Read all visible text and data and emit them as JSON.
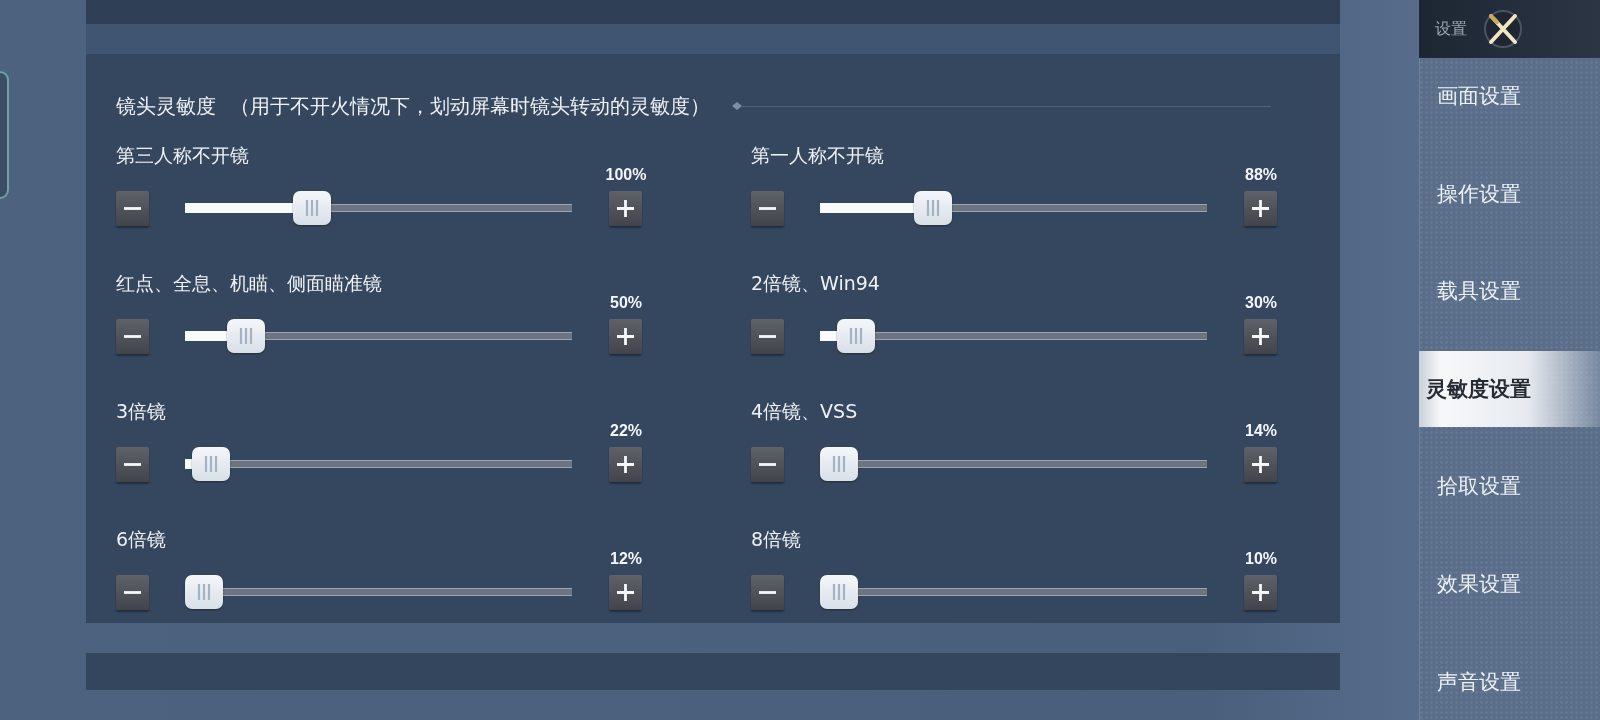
{
  "panel": {
    "title": "镜头灵敏度",
    "note": "（用于不开火情况下，划动屏幕时镜头转动的灵敏度）",
    "sliders": [
      {
        "label": "第三人称不开镜",
        "reading": "100%",
        "level": 0.31
      },
      {
        "label": "第一人称不开镜",
        "reading": "88%",
        "level": 0.27
      },
      {
        "label": "红点、全息、机瞄、侧面瞄准镜",
        "reading": "50%",
        "level": 0.12
      },
      {
        "label": "2倍镜、Win94",
        "reading": "30%",
        "level": 0.05
      },
      {
        "label": "3倍镜",
        "reading": "22%",
        "level": 0.02
      },
      {
        "label": "4倍镜、VSS",
        "reading": "14%",
        "level": 0.0
      },
      {
        "label": "6倍镜",
        "reading": "12%",
        "level": 0.0
      },
      {
        "label": "8倍镜",
        "reading": "10%",
        "level": 0.0
      }
    ]
  },
  "sidebar": {
    "title": "设置",
    "items": [
      {
        "label": "画面设置",
        "selected": false
      },
      {
        "label": "操作设置",
        "selected": false
      },
      {
        "label": "载具设置",
        "selected": false
      },
      {
        "label": "灵敏度设置",
        "selected": true
      },
      {
        "label": "拾取设置",
        "selected": false
      },
      {
        "label": "效果设置",
        "selected": false
      },
      {
        "label": "声音设置",
        "selected": false
      }
    ]
  }
}
